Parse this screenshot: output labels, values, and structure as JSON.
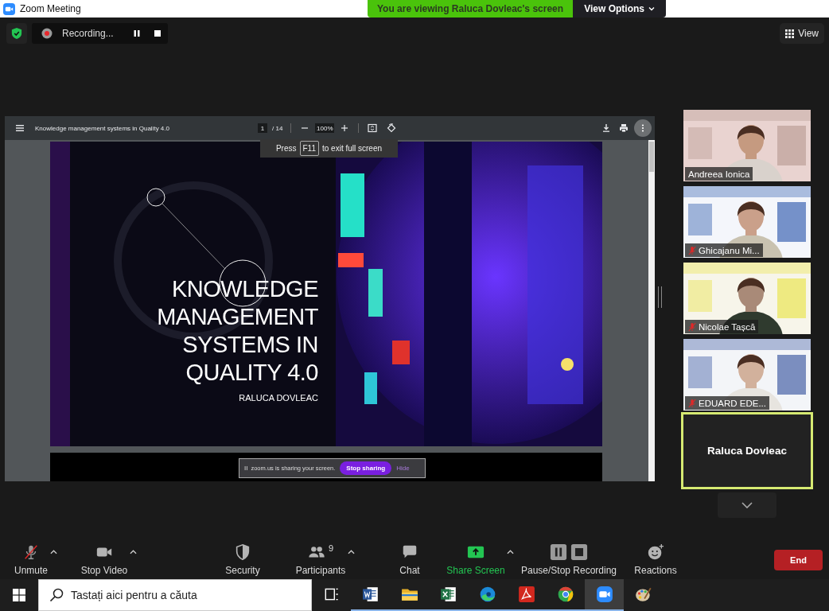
{
  "window": {
    "title": "Zoom Meeting"
  },
  "share_banner": {
    "text": "You are viewing Raluca Dovleac's screen",
    "options": "View Options"
  },
  "recording": {
    "label": "Recording..."
  },
  "view_button": "View",
  "pdf_viewer": {
    "title": "Knowledge management systems in Quality 4.0",
    "page": "1",
    "pages": "/ 14",
    "zoom": "100%"
  },
  "fullscreen_hint": {
    "before": "Press",
    "key": "F11",
    "after": "to exit full screen"
  },
  "slide": {
    "title_lines": [
      "KNOWLEDGE",
      "MANAGEMENT",
      "SYSTEMS IN",
      "QUALITY 4.0"
    ],
    "author": "RALUCA DOVLEAC"
  },
  "sharing_bar": {
    "handle": "II",
    "text": "zoom.us is sharing your screen.",
    "stop": "Stop sharing",
    "hide": "Hide"
  },
  "participants": [
    {
      "kind": "video",
      "name": "Andreea Ionica",
      "muted": false,
      "active_speaker": false
    },
    {
      "kind": "video",
      "name": "Ghicajanu Mi...",
      "muted": true,
      "active_speaker": false
    },
    {
      "kind": "video",
      "name": "Nicolae Tașcă",
      "muted": true,
      "active_speaker": false
    },
    {
      "kind": "video",
      "name": "EDUARD EDE...",
      "muted": true,
      "active_speaker": false
    },
    {
      "kind": "name",
      "name": "Raluca Dovleac",
      "active_speaker": true
    }
  ],
  "controls": [
    {
      "kind": "audio",
      "label": "Unmute",
      "caret": true,
      "highlighted": false
    },
    {
      "kind": "video",
      "label": "Stop Video",
      "caret": true,
      "highlighted": false
    },
    {
      "kind": "security",
      "label": "Security",
      "caret": false,
      "highlighted": false
    },
    {
      "kind": "participants",
      "label": "Participants",
      "count": "9",
      "caret": true,
      "highlighted": false
    },
    {
      "kind": "chat",
      "label": "Chat",
      "caret": false,
      "highlighted": false
    },
    {
      "kind": "share",
      "label": "Share Screen",
      "caret": true,
      "highlighted": true
    },
    {
      "kind": "recording",
      "label": "Pause/Stop Recording",
      "caret": false,
      "highlighted": false
    },
    {
      "kind": "reactions",
      "label": "Reactions",
      "caret": false,
      "highlighted": false
    }
  ],
  "end_button": "End",
  "taskbar": {
    "search_placeholder": "Tastați aici pentru a căuta",
    "apps": [
      {
        "kind": "task-view",
        "running": false,
        "selected": false
      },
      {
        "kind": "word",
        "running": true,
        "selected": false
      },
      {
        "kind": "folder",
        "running": true,
        "selected": false
      },
      {
        "kind": "excel",
        "running": true,
        "selected": false
      },
      {
        "kind": "edge",
        "running": true,
        "selected": false
      },
      {
        "kind": "acrobat",
        "running": true,
        "selected": false
      },
      {
        "kind": "chrome",
        "running": true,
        "selected": false
      },
      {
        "kind": "zoom",
        "running": true,
        "selected": true
      },
      {
        "kind": "paint",
        "running": false,
        "selected": false
      }
    ]
  }
}
